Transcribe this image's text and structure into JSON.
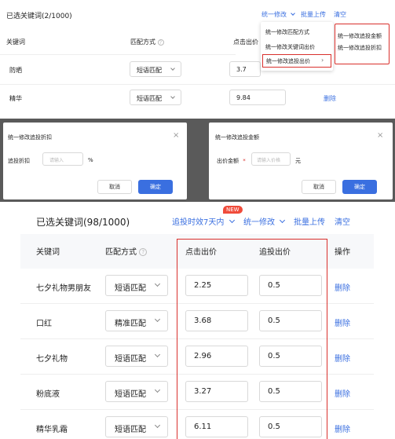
{
  "top_panel": {
    "title": "已选关键词(2/1000)",
    "actions": {
      "batch_modify": "统一修改",
      "batch_upload": "批量上传",
      "clear": "清空"
    },
    "headers": {
      "keyword": "关键词",
      "match": "匹配方式",
      "bid": "点击出价"
    },
    "rows": [
      {
        "keyword": "防晒",
        "match": "短语匹配",
        "bid": "3.7",
        "action": ""
      },
      {
        "keyword": "精华",
        "match": "短语匹配",
        "bid": "9.84",
        "action": "删除"
      }
    ],
    "dropdown": {
      "items": [
        "统一修改匹配方式",
        "统一修改关键词出价",
        "统一修改追投出价"
      ],
      "sub_items": [
        "统一修改追投金额",
        "统一修改追投折扣"
      ]
    }
  },
  "discount_dialog": {
    "title": "统一修改追投折扣",
    "label": "追投折扣",
    "placeholder": "请输入",
    "unit": "%",
    "cancel": "取消",
    "confirm": "确定"
  },
  "amount_dialog": {
    "title": "统一修改追投金额",
    "label": "出价金额",
    "required": "*",
    "placeholder": "请输入价格",
    "unit": "元",
    "cancel": "取消",
    "confirm": "确定"
  },
  "bottom_panel": {
    "title": "已选关键词(98/1000)",
    "actions": {
      "schedule": "追投时效7天内",
      "new_badge": "NEW",
      "batch_modify": "统一修改",
      "batch_upload": "批量上传",
      "clear": "清空"
    },
    "headers": {
      "keyword": "关键词",
      "match": "匹配方式",
      "bid": "点击出价",
      "follow_bid": "追投出价",
      "ops": "操作"
    },
    "rows": [
      {
        "keyword": "七夕礼物男朋友",
        "match": "短语匹配",
        "bid": "2.25",
        "follow_bid": "0.5",
        "action": "删除"
      },
      {
        "keyword": "口红",
        "match": "精准匹配",
        "bid": "3.68",
        "follow_bid": "0.5",
        "action": "删除"
      },
      {
        "keyword": "七夕礼物",
        "match": "短语匹配",
        "bid": "2.96",
        "follow_bid": "0.5",
        "action": "删除"
      },
      {
        "keyword": "粉底液",
        "match": "短语匹配",
        "bid": "3.27",
        "follow_bid": "0.5",
        "action": "删除"
      },
      {
        "keyword": "精华乳霜",
        "match": "短语匹配",
        "bid": "6.11",
        "follow_bid": "0.5",
        "action": "删除"
      }
    ]
  },
  "colors": {
    "accent": "#3a6fe0",
    "highlight": "#d9302c",
    "badge": "#f04b3a"
  }
}
